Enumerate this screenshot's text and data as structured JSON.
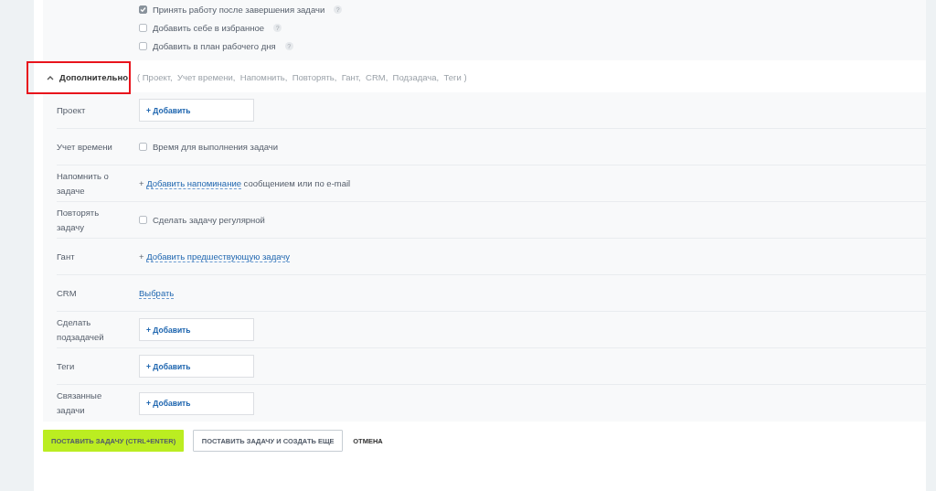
{
  "options": [
    {
      "label": "Принять работу после завершения задачи",
      "checked": true,
      "help": "?"
    },
    {
      "label": "Добавить себе в избранное",
      "checked": false,
      "help": "?"
    },
    {
      "label": "Добавить в план рабочего дня",
      "checked": false,
      "help": "?"
    }
  ],
  "extra": {
    "title": "Дополнительно",
    "expanded": true,
    "highlighted": true,
    "summary": "( Проект,  Учет времени,  Напомнить,  Повторять,  Гант,  CRM,  Подзадача,  Теги )"
  },
  "fields": [
    {
      "label": "Проект",
      "kind": "selector",
      "action": "+ Добавить"
    },
    {
      "label": "Учет времени",
      "kind": "checkbox",
      "text": "Время для выполнения задачи",
      "checked": false
    },
    {
      "label": "Напомнить о задаче",
      "kind": "link",
      "prefix": "+",
      "link": "Добавить напоминание",
      "suffix": "сообщением или по e-mail"
    },
    {
      "label": "Повторять задачу",
      "kind": "checkbox",
      "text": "Сделать задачу регулярной",
      "checked": false
    },
    {
      "label": "Гант",
      "kind": "link",
      "prefix": "+",
      "link": "Добавить предшествующую задачу"
    },
    {
      "label": "CRM",
      "kind": "link",
      "link": "Выбрать"
    },
    {
      "label": "Сделать подзадачей",
      "kind": "selector",
      "action": "+ Добавить"
    },
    {
      "label": "Теги",
      "kind": "selector",
      "action": "+ Добавить"
    },
    {
      "label": "Связанные задачи",
      "kind": "selector",
      "action": "+ Добавить"
    }
  ],
  "buttons": [
    {
      "label": "ПОСТАВИТЬ ЗАДАЧУ (CTRL+ENTER)",
      "kind": "primary"
    },
    {
      "label": "ПОСТАВИТЬ ЗАДАЧУ И СОЗДАТЬ ЕЩЕ",
      "kind": "secondary"
    },
    {
      "label": "ОТМЕНА",
      "kind": "link"
    }
  ]
}
